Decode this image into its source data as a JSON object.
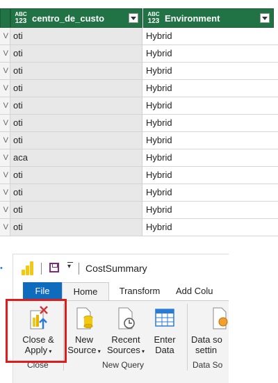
{
  "grid": {
    "columns": [
      {
        "type_top": "ABC",
        "type_bottom": "123",
        "name": "centro_de_custo"
      },
      {
        "type_top": "ABC",
        "type_bottom": "123",
        "name": "Environment"
      }
    ],
    "rows": [
      {
        "marker": "V",
        "c1": "oti",
        "c2": "Hybrid"
      },
      {
        "marker": "V",
        "c1": "oti",
        "c2": "Hybrid"
      },
      {
        "marker": "V",
        "c1": "oti",
        "c2": "Hybrid"
      },
      {
        "marker": "V",
        "c1": "oti",
        "c2": "Hybrid"
      },
      {
        "marker": "V",
        "c1": "oti",
        "c2": "Hybrid"
      },
      {
        "marker": "V",
        "c1": "oti",
        "c2": "Hybrid"
      },
      {
        "marker": "V",
        "c1": "oti",
        "c2": "Hybrid"
      },
      {
        "marker": "V",
        "c1": "aca",
        "c2": "Hybrid"
      },
      {
        "marker": "V",
        "c1": "oti",
        "c2": "Hybrid"
      },
      {
        "marker": "V",
        "c1": "oti",
        "c2": "Hybrid"
      },
      {
        "marker": "V",
        "c1": "oti",
        "c2": "Hybrid"
      },
      {
        "marker": "V",
        "c1": "oti",
        "c2": "Hybrid"
      }
    ]
  },
  "ribbon": {
    "window_title": "CostSummary",
    "tabs": [
      "File",
      "Home",
      "Transform",
      "Add Colu"
    ],
    "buttons": {
      "close_apply": {
        "line1": "Close &",
        "line2": "Apply"
      },
      "new_source": {
        "line1": "New",
        "line2": "Source"
      },
      "recent_sources": {
        "line1": "Recent",
        "line2": "Sources"
      },
      "enter_data": {
        "line1": "Enter",
        "line2": "Data"
      },
      "data_source_settings": {
        "line1": "Data so",
        "line2": "settin"
      }
    },
    "groups": {
      "close": "Close",
      "new_query": "New Query",
      "data_sources": "Data So"
    }
  },
  "colors": {
    "header_bg": "#217346",
    "file_tab": "#0f6cbd",
    "highlight": "#e01b1b",
    "powerbi_yellow": "#f2c811"
  }
}
